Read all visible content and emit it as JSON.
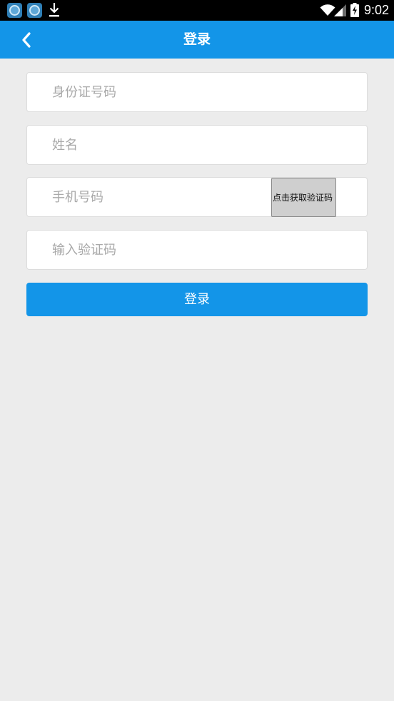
{
  "status_bar": {
    "time": "9:02",
    "icons": [
      "app-icon",
      "app-icon",
      "download-icon",
      "wifi-icon",
      "signal-icon",
      "battery-charging-icon"
    ]
  },
  "header": {
    "back_icon": "chevron-left-icon",
    "title": "登录"
  },
  "form": {
    "id_number_placeholder": "身份证号码",
    "name_placeholder": "姓名",
    "phone_placeholder": "手机号码",
    "get_code_label": "点击获取验证码",
    "code_placeholder": "输入验证码",
    "login_label": "登录"
  },
  "colors": {
    "accent": "#1395e8",
    "background": "#ececec",
    "status_bar": "#000000"
  }
}
